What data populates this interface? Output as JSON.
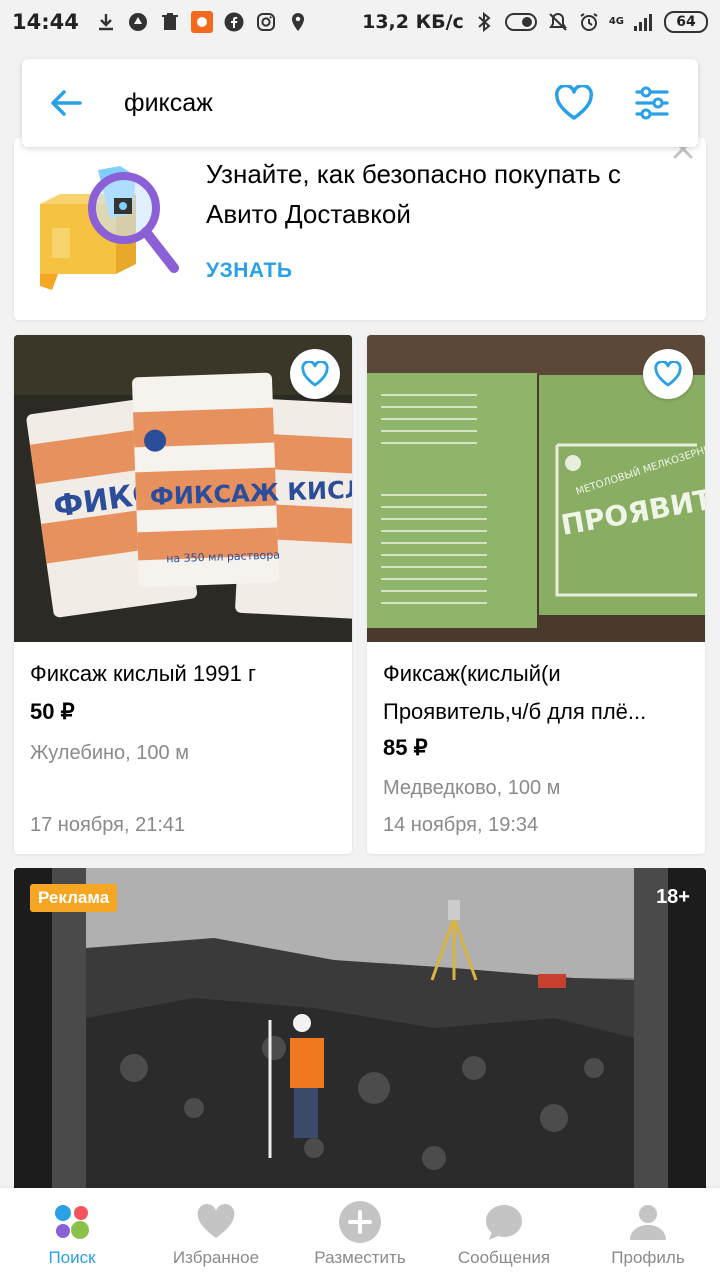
{
  "status_bar": {
    "time": "14:44",
    "net_speed": "13,2 КБ/с",
    "network_type": "4G",
    "battery": "64"
  },
  "search": {
    "query": "фиксаж",
    "accent_color": "#2aa0e6"
  },
  "promo": {
    "title": "Узнайте, как безопасно покупать с Авито Доставкой",
    "link_label": "УЗНАТЬ"
  },
  "listings": [
    {
      "title": "Фиксаж кислый 1991 г",
      "price": "50 ₽",
      "location": "Жулебино, 100 м",
      "date": "17 ноября, 21:41",
      "photo_label": "ФИКСАЖ КИСЛЫЙ",
      "photo_caption": "на 350 мл раствора"
    },
    {
      "title": "Фиксаж(кислый(и Проявитель,ч/б для плё...",
      "price": "85 ₽",
      "location": "Медведково, 100 м",
      "date": "14 ноября, 19:34",
      "photo_label": "ПРОЯВИТЕЛЬ",
      "photo_caption": "МЕТОЛОВЫЙ МЕЛКОЗЕРНИСТЫЙ"
    }
  ],
  "ad": {
    "badge": "Реклама",
    "age_rating": "18+"
  },
  "bottom_nav": [
    {
      "label": "Поиск",
      "icon": "search-dots-icon",
      "active": true
    },
    {
      "label": "Избранное",
      "icon": "heart-icon",
      "active": false
    },
    {
      "label": "Разместить",
      "icon": "plus-circle-icon",
      "active": false
    },
    {
      "label": "Сообщения",
      "icon": "chat-bubble-icon",
      "active": false
    },
    {
      "label": "Профиль",
      "icon": "user-icon",
      "active": false
    }
  ]
}
